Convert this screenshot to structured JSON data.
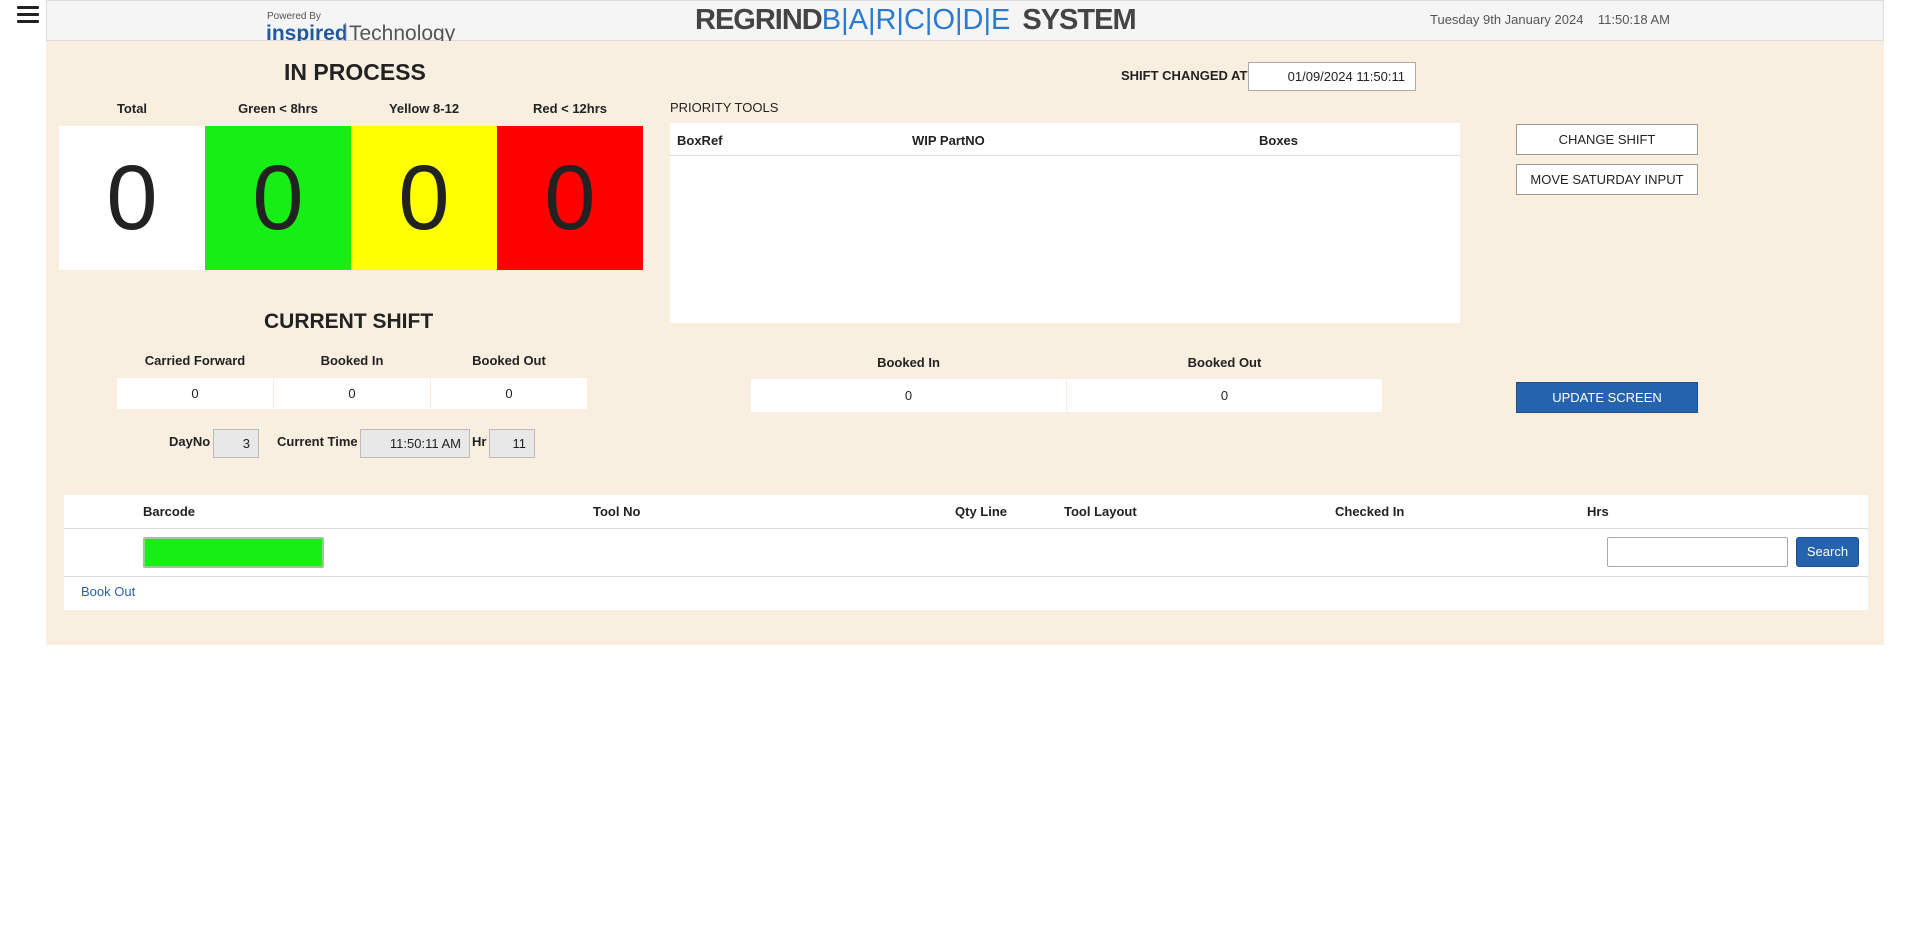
{
  "header": {
    "powered_by": "Powered By",
    "brand_bold": "inspired",
    "brand_light": "Technology",
    "title_left": "REGRIND",
    "title_barcode": "B|A|R|C|O|D|E",
    "title_right": "SYSTEM",
    "date": "Tuesday 9th January 2024",
    "time": "11:50:18 AM"
  },
  "in_process": {
    "title": "IN PROCESS",
    "buckets": [
      {
        "label": "Total",
        "value": "0",
        "color": "#ffffff"
      },
      {
        "label": "Green < 8hrs",
        "value": "0",
        "color": "#16ee16"
      },
      {
        "label": "Yellow 8-12",
        "value": "0",
        "color": "#ffff00"
      },
      {
        "label": "Red < 12hrs",
        "value": "0",
        "color": "#ff0000"
      }
    ]
  },
  "shift_changed": {
    "label": "SHIFT CHANGED AT",
    "value": "01/09/2024 11:50:11"
  },
  "priority_tools": {
    "title": "PRIORITY TOOLS",
    "columns": [
      "BoxRef",
      "WIP PartNO",
      "Boxes"
    ]
  },
  "buttons": {
    "change_shift": "CHANGE SHIFT",
    "move_saturday": "MOVE SATURDAY INPUT",
    "update_screen": "UPDATE SCREEN",
    "search": "Search"
  },
  "current_shift": {
    "title": "CURRENT SHIFT",
    "carried_forward_label": "Carried Forward",
    "carried_forward": "0",
    "booked_in_label": "Booked In",
    "booked_in": "0",
    "booked_out_label": "Booked Out",
    "booked_out": "0"
  },
  "totals": {
    "booked_in_label": "Booked In",
    "booked_in": "0",
    "booked_out_label": "Booked Out",
    "booked_out": "0"
  },
  "timing": {
    "dayno_label": "DayNo",
    "dayno": "3",
    "current_time_label": "Current Time",
    "current_time": "11:50:11 AM",
    "hr_label": "Hr",
    "hr": "11"
  },
  "grid": {
    "columns": [
      "Barcode",
      "Tool No",
      "Qty Line",
      "Tool Layout",
      "Checked In",
      "Hrs"
    ],
    "barcode_value": "",
    "search_value": "",
    "book_out_link": "Book Out"
  },
  "colors": {
    "panel_bg": "#f9efe1",
    "accent_blue": "#2563ae",
    "barcode_green": "#16ee16"
  }
}
